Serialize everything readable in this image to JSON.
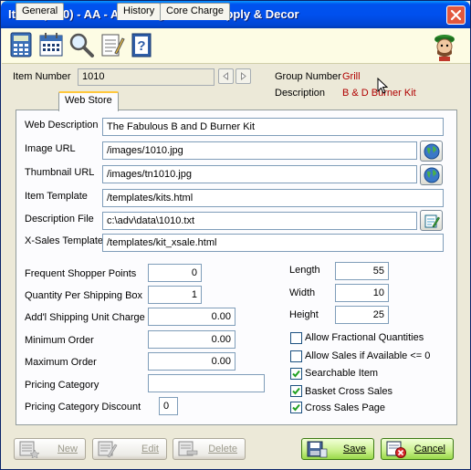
{
  "window": {
    "title": "Items (5.00) - AA - Advantage Home Supply & Decor"
  },
  "toolbar": {
    "icons": [
      "calculator-icon",
      "calendar-icon",
      "magnifier-icon",
      "notepad-icon",
      "help-book-icon",
      "mascot-icon"
    ]
  },
  "header": {
    "item_number_label": "Item Number",
    "item_number_value": "1010",
    "group_number_label": "Group Number",
    "group_number_value": "Grill",
    "description_label": "Description",
    "description_value": "B & D Burner Kit"
  },
  "tabs": [
    {
      "label": "General"
    },
    {
      "label": "Web Store"
    },
    {
      "label": "History"
    },
    {
      "label": "Core Charge"
    }
  ],
  "webstore": {
    "web_description_label": "Web Description",
    "web_description_value": "The Fabulous B and D Burner Kit",
    "image_url_label": "Image URL",
    "image_url_value": "/images/1010.jpg",
    "thumbnail_url_label": "Thumbnail URL",
    "thumbnail_url_value": "/images/tn1010.jpg",
    "item_template_label": "Item Template",
    "item_template_value": "/templates/kits.html",
    "description_file_label": "Description File",
    "description_file_value": "c:\\adv\\data\\1010.txt",
    "xsales_template_label": "X-Sales Template",
    "xsales_template_value": "/templates/kit_xsale.html"
  },
  "fields": {
    "frequent_shopper_label": "Frequent Shopper Points",
    "frequent_shopper_value": "0",
    "qty_per_box_label": "Quantity Per Shipping Box",
    "qty_per_box_value": "1",
    "addl_shipping_label": "Add'l Shipping Unit Charge",
    "addl_shipping_value": "0.00",
    "min_order_label": "Minimum Order",
    "min_order_value": "0.00",
    "max_order_label": "Maximum Order",
    "max_order_value": "0.00",
    "pricing_category_label": "Pricing Category",
    "pricing_category_value": "",
    "pricing_discount_label": "Pricing Category Discount",
    "pricing_discount_value": "0",
    "length_label": "Length",
    "length_value": "55",
    "width_label": "Width",
    "width_value": "10",
    "height_label": "Height",
    "height_value": "25"
  },
  "checkboxes": [
    {
      "label": "Allow Fractional Quantities",
      "checked": false
    },
    {
      "label": "Allow Sales if Available <= 0",
      "checked": false
    },
    {
      "label": "Searchable Item",
      "checked": true
    },
    {
      "label": "Basket Cross Sales",
      "checked": true
    },
    {
      "label": "Cross Sales Page",
      "checked": true
    }
  ],
  "buttons": {
    "new_label": "New",
    "edit_label": "Edit",
    "delete_label": "Delete",
    "save_label": "Save",
    "cancel_label": "Cancel"
  },
  "colors": {
    "title_bar": "#0054e3",
    "accent_value": "#b00000",
    "check_green": "#21a121"
  }
}
